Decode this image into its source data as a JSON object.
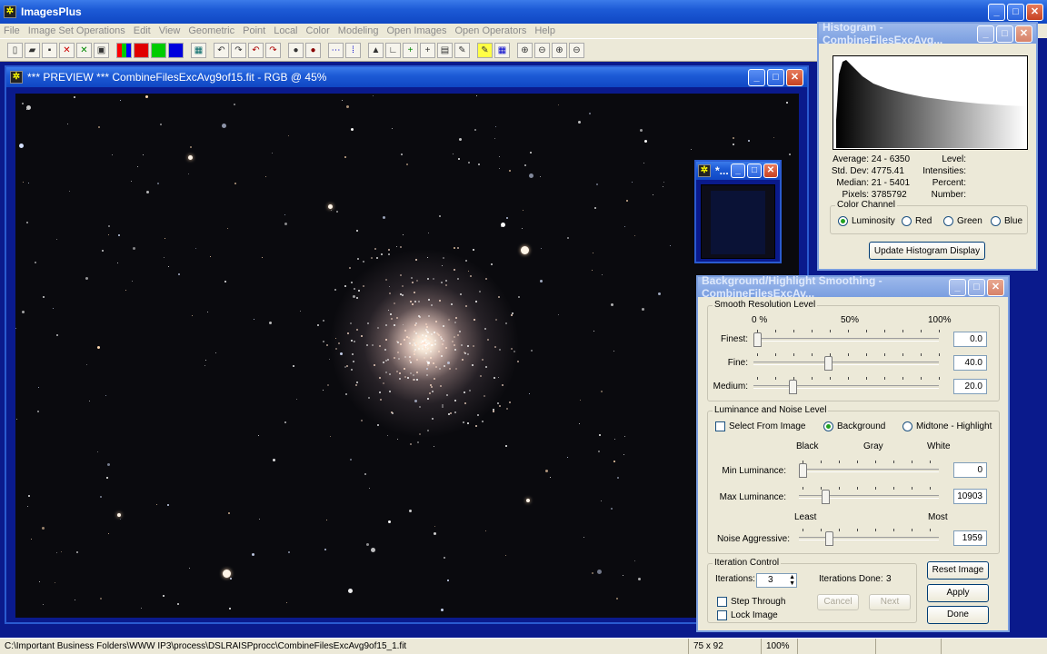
{
  "app": {
    "title": "ImagesPlus"
  },
  "menu": [
    "File",
    "Image Set Operations",
    "Edit",
    "View",
    "Geometric",
    "Point",
    "Local",
    "Color",
    "Modeling",
    "Open Images",
    "Open Operators",
    "Help"
  ],
  "preview": {
    "title": "*** PREVIEW *** CombineFilesExcAvg9of15.fit - RGB @ 45%"
  },
  "mini": {
    "title": "*..."
  },
  "histogram": {
    "title": "Histogram - CombineFilesExcAvg...",
    "stats": {
      "average_label": "Average:",
      "average": "24 - 6350",
      "stddev_label": "Std. Dev:",
      "stddev": "4775.41",
      "median_label": "Median:",
      "median": "21 - 5401",
      "pixels_label": "Pixels:",
      "pixels": "3785792",
      "level_label": "Level:",
      "intensities_label": "Intensities:",
      "percent_label": "Percent:",
      "number_label": "Number:"
    },
    "channel_group": "Color Channel",
    "channels": {
      "lum": "Luminosity",
      "red": "Red",
      "green": "Green",
      "blue": "Blue"
    },
    "selected_channel": "Luminosity",
    "update_button": "Update Histogram Display"
  },
  "smoothing": {
    "title": "Background/Highlight Smoothing - CombineFilesExcAv...",
    "resolution_group": "Smooth Resolution Level",
    "scale_labels": {
      "min": "0 %",
      "mid": "50%",
      "max": "100%"
    },
    "finest_label": "Finest:",
    "finest": "0.0",
    "finest_level": 0.0,
    "fine_label": "Fine:",
    "fine": "40.0",
    "fine_level": 0.4,
    "medium_label": "Medium:",
    "medium": "20.0",
    "medium_level": 0.2,
    "luminance_group": "Luminance and Noise Level",
    "select_from_image": "Select From Image",
    "background": "Background",
    "midtone_highlight": "Midtone - Highlight",
    "lum_scale": {
      "black": "Black",
      "gray": "Gray",
      "white": "White"
    },
    "min_lum_label": "Min Luminance:",
    "min_lum": "0",
    "min_lum_level": 0.0,
    "max_lum_label": "Max Luminance:",
    "max_lum": "10903",
    "max_lum_level": 0.17,
    "noise_scale": {
      "least": "Least",
      "most": "Most"
    },
    "noise_label": "Noise Aggressive:",
    "noise": "1959",
    "noise_level": 0.2,
    "iteration_group": "Iteration Control",
    "iterations_label": "Iterations:",
    "iterations": "3",
    "iterations_done_label": "Iterations Done:",
    "iterations_done": "3",
    "step_through": "Step Through",
    "lock_image": "Lock Image",
    "cancel": "Cancel",
    "next": "Next",
    "reset": "Reset Image",
    "apply": "Apply",
    "done": "Done"
  },
  "status": {
    "path": "C:\\Important Business Folders\\WWW IP3\\process\\DSLRAISPprocc\\CombineFilesExcAvg9of15_1.fit",
    "dims": "75 x 92",
    "zoom": "100%"
  }
}
